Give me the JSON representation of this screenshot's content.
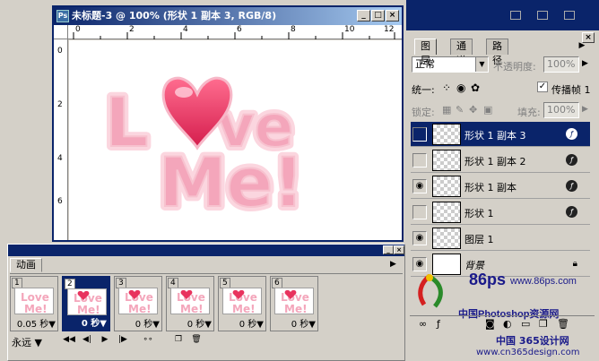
{
  "document": {
    "title": "未标题-3 @ 100% (形状 1 副本 3, RGB/8)",
    "ruler_top_marks": [
      "0",
      "2",
      "4",
      "6",
      "8",
      "10",
      "12"
    ],
    "ruler_left_marks": [
      "0",
      "2",
      "4",
      "6"
    ],
    "artwork": {
      "line1": "Love",
      "line2": "Me!"
    }
  },
  "layers_panel": {
    "tabs": [
      "图层",
      "通道",
      "路径"
    ],
    "active_tab": "图层",
    "blend_mode": "正常",
    "opacity_label": "不透明度:",
    "opacity_value": "100%",
    "unify_label": "统一:",
    "propagate_label": "传播帧 1",
    "propagate_checked": true,
    "lock_label": "锁定:",
    "fill_label": "填充:",
    "fill_value": "100%",
    "layers": [
      {
        "name": "形状 1 副本 3",
        "visible": false,
        "selected": true,
        "effects": true
      },
      {
        "name": "形状 1 副本 2",
        "visible": false,
        "selected": false,
        "effects": true
      },
      {
        "name": "形状 1 副本",
        "visible": true,
        "selected": false,
        "effects": true
      },
      {
        "name": "形状 1",
        "visible": false,
        "selected": false,
        "effects": true
      },
      {
        "name": "图层 1",
        "visible": true,
        "selected": false,
        "effects": false
      },
      {
        "name": "背景",
        "visible": true,
        "selected": false,
        "effects": false,
        "locked": true
      }
    ]
  },
  "animation_panel": {
    "tab": "动画",
    "frames": [
      {
        "number": "1",
        "delay": "0.05 秒▼"
      },
      {
        "number": "2",
        "delay": "0 秒▼"
      },
      {
        "number": "3",
        "delay": "0 秒▼"
      },
      {
        "number": "4",
        "delay": "0 秒▼"
      },
      {
        "number": "5",
        "delay": "0 秒▼"
      },
      {
        "number": "6",
        "delay": "0 秒▼"
      }
    ],
    "selected_frame": "2",
    "loop_option": "永远"
  },
  "watermark": {
    "logo_text": "86ps",
    "url": "www.86ps.com",
    "site_name": "中国Photoshop资源网",
    "footer_line1": "中国 365设计网",
    "footer_line2": "www.cn365design.com"
  },
  "colors": {
    "titlebar": "#0a246a",
    "heart": "#e8335e",
    "letters": "#f4a6bb"
  }
}
